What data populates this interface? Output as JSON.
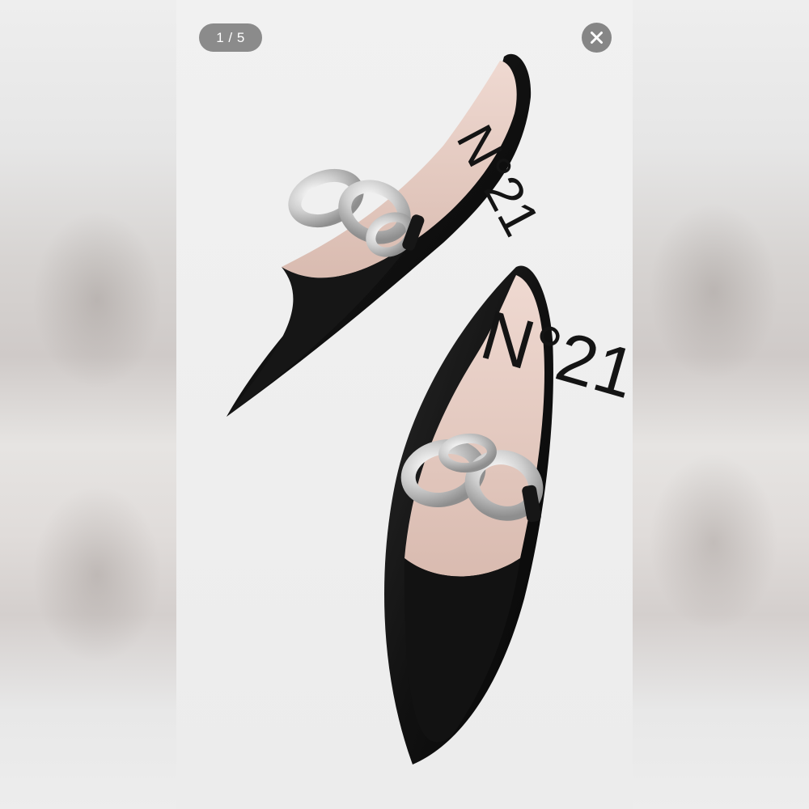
{
  "viewer": {
    "counter_text": "1 / 5",
    "close_icon": "close-icon"
  },
  "photo": {
    "brand_insole_text": "N°21",
    "colors": {
      "leather": "#151515",
      "lining": "#e6cdc4",
      "chain": "#d9d9d9",
      "background": "#efefef"
    }
  }
}
